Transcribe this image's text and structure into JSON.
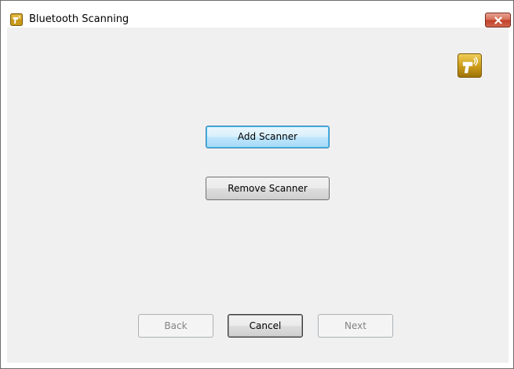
{
  "window": {
    "title": "Bluetooth Scanning",
    "icon": "scanner-app-icon",
    "close_icon": "close-icon"
  },
  "main": {
    "logo_icon": "bluetooth-scanner-logo-icon",
    "add_scanner_label": "Add Scanner",
    "remove_scanner_label": "Remove Scanner"
  },
  "footer": {
    "back_label": "Back",
    "cancel_label": "Cancel",
    "next_label": "Next",
    "back_enabled": false,
    "next_enabled": false
  },
  "colors": {
    "accent": "#3c7fb1",
    "brand_gold": "#c79a12",
    "close_red": "#c1402a"
  }
}
